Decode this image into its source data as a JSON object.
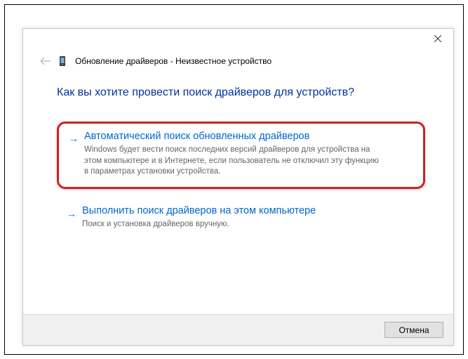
{
  "header": {
    "title": "Обновление драйверов - Неизвестное устройство"
  },
  "content": {
    "heading": "Как вы хотите провести поиск драйверов для устройств?",
    "options": [
      {
        "title": "Автоматический поиск обновленных драйверов",
        "desc": "Windows будет вести поиск последних версий драйверов для устройства на этом компьютере и в Интернете, если пользователь не отключил эту функцию в параметрах установки устройства."
      },
      {
        "title": "Выполнить поиск драйверов на этом компьютере",
        "desc": "Поиск и установка драйверов вручную."
      }
    ]
  },
  "footer": {
    "cancel": "Отмена"
  }
}
